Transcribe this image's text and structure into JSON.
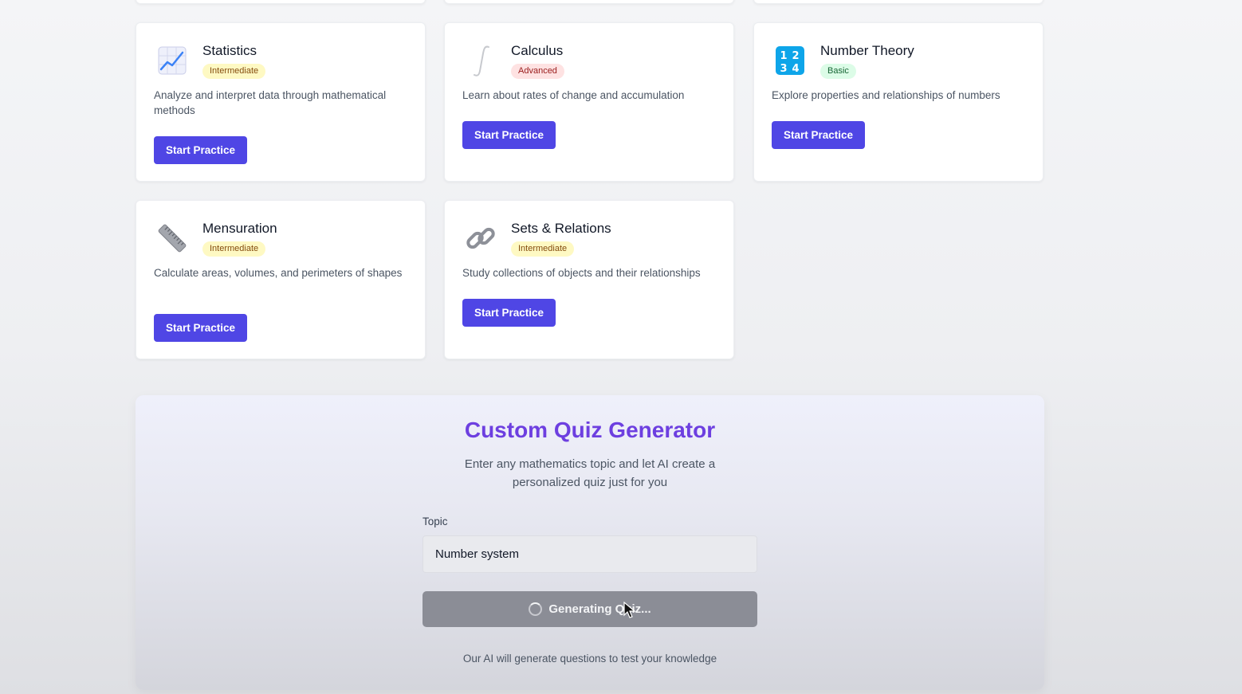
{
  "cards": [
    {
      "title": "Statistics",
      "badge": "Intermediate",
      "description": "Analyze and interpret data through mathematical methods",
      "button": "Start Practice",
      "icon": "chart-increasing-icon"
    },
    {
      "title": "Calculus",
      "badge": "Advanced",
      "description": "Learn about rates of change and accumulation",
      "button": "Start Practice",
      "icon": "integral-icon"
    },
    {
      "title": "Number Theory",
      "badge": "Basic",
      "description": "Explore properties and relationships of numbers",
      "button": "Start Practice",
      "icon": "numbers-1234-icon"
    },
    {
      "title": "Mensuration",
      "badge": "Intermediate",
      "description": "Calculate areas, volumes, and perimeters of shapes",
      "button": "Start Practice",
      "icon": "ruler-icon"
    },
    {
      "title": "Sets & Relations",
      "badge": "Intermediate",
      "description": "Study collections of objects and their relationships",
      "button": "Start Practice",
      "icon": "link-icon"
    }
  ],
  "quiz": {
    "title": "Custom Quiz Generator",
    "subtitle": "Enter any mathematics topic and let AI create a personalized quiz just for you",
    "topic_label": "Topic",
    "topic_value": "Number system",
    "generate_button": "Generating Quiz...",
    "note": "Our AI will generate questions to test your knowledge"
  },
  "colors": {
    "primary": "#4f46e5",
    "title_gradient": "#6d3fe0",
    "badge_intermediate": "#fef9c3",
    "badge_advanced": "#fee2e2",
    "badge_basic": "#dcfce7"
  }
}
